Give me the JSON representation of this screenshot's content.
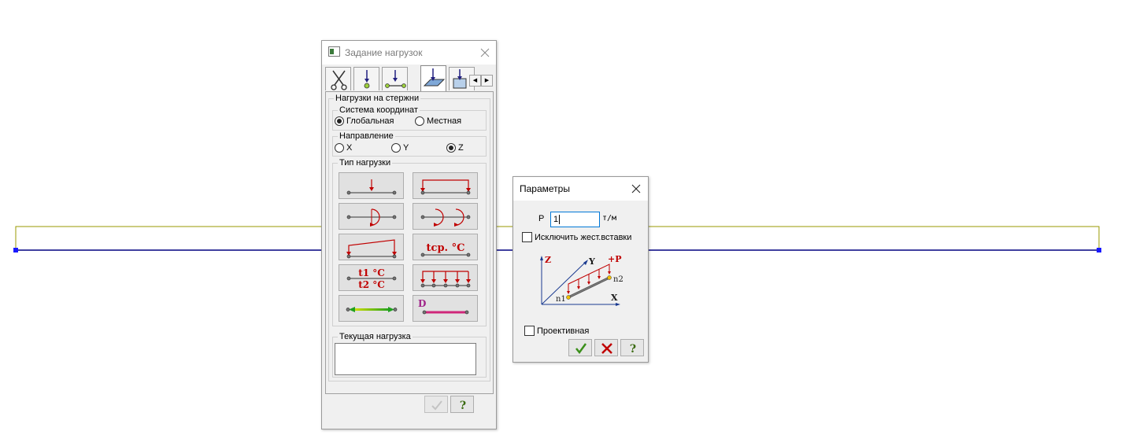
{
  "load_dialog": {
    "title": "Задание нагрузок",
    "tabs": [
      "scissors-icon",
      "node-load-icon",
      "bar-load-icon",
      "plate-load-icon",
      "solid-load-icon"
    ],
    "bar_loads_group": "Нагрузки на стержни",
    "coord_system": {
      "title": "Система координат",
      "options": [
        "Глобальная",
        "Местная"
      ],
      "selected": "Глобальная"
    },
    "direction": {
      "title": "Направление",
      "options": [
        "X",
        "Y",
        "Z"
      ],
      "selected": "Z"
    },
    "load_type_title": "Тип нагрузки",
    "load_types": {
      "temp_avg_text": "tср. °C",
      "temp_top_text": "t1 °C",
      "temp_bottom_text": "t2 °C",
      "displacement_letter": "D"
    },
    "current_load_title": "Текущая нагрузка",
    "current_load_value": ""
  },
  "params_dialog": {
    "title": "Параметры",
    "p_label": "P",
    "p_value": "1",
    "p_unit": "т/м",
    "exclude_rigid_inserts": "Исключить жест.вставки",
    "exclude_rigid_inserts_checked": false,
    "diagram_labels": {
      "z": "Z",
      "y": "Y",
      "x": "X",
      "p": "+P",
      "n1": "n1",
      "n2": "n2"
    },
    "projective": "Проективная",
    "projective_checked": false,
    "ok": "✓",
    "cancel": "✗",
    "help": "?"
  },
  "colors": {
    "load_red": "#c00000",
    "beam_navy": "#000080",
    "beam_olive": "#a0a000",
    "ok_green": "#3a8f1a"
  }
}
